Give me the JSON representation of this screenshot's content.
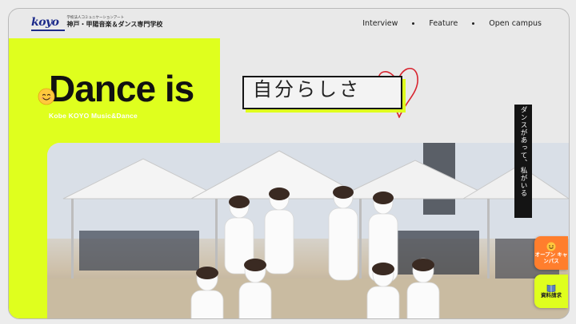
{
  "header": {
    "logo_text": "koyo",
    "school_sub": "学校法人コミュニケーションアート",
    "school_name": "神戸・甲陽音楽＆ダンス専門学校",
    "nav": [
      {
        "label": "Interview"
      },
      {
        "label": "Feature"
      },
      {
        "label": "Open campus"
      }
    ]
  },
  "hero": {
    "headline": "Dance is",
    "headline_jp": "自分らしさ",
    "sub_caption": "Kobe KOYO Music&Dance",
    "vertical_tag": "ダンスがあって、私がいる"
  },
  "side_buttons": {
    "open_campus": "オープン キャンパス",
    "document_request": "資料請求"
  },
  "colors": {
    "accent_lime": "#dfff1e",
    "accent_orange": "#ff7e2d",
    "brand_navy": "#1c2a8a"
  }
}
